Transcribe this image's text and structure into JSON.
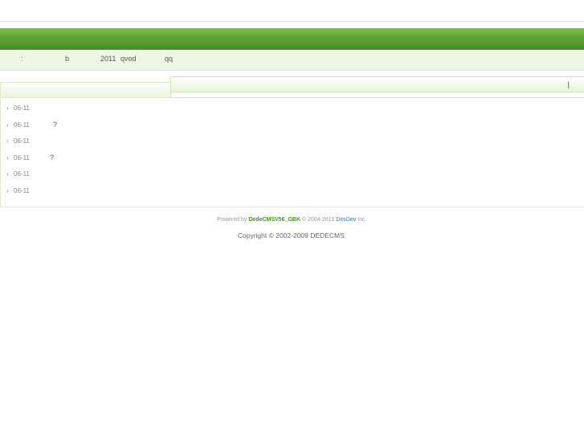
{
  "hotbar": {
    "colon": ":",
    "b": "b",
    "year": "2011",
    "qvod": "qvod",
    "qq": "qq"
  },
  "right_header": {
    "marker": "|"
  },
  "list": [
    {
      "arrow": "›",
      "date": "06-11",
      "mark": ""
    },
    {
      "arrow": "›",
      "date": "06-11",
      "mark": "?"
    },
    {
      "arrow": "›",
      "date": "06-11",
      "mark": ""
    },
    {
      "arrow": "›",
      "date": "06-11",
      "mark": "?"
    },
    {
      "arrow": "›",
      "date": "06-11",
      "mark": ""
    },
    {
      "arrow": "›",
      "date": "06-11",
      "mark": ""
    }
  ],
  "footer": {
    "powered_by": "Powered by",
    "brand": "DedeCMSV56_GBK",
    "copy_years": "© 2004-2010",
    "dev": "DesDev",
    "inc": "Inc.",
    "copyright": "Copyright © 2002-2009 DEDECMS."
  },
  "colors": {
    "green_top": "#7fc04a",
    "green_bottom": "#4a8d23",
    "light_green": "#eef7e3"
  }
}
